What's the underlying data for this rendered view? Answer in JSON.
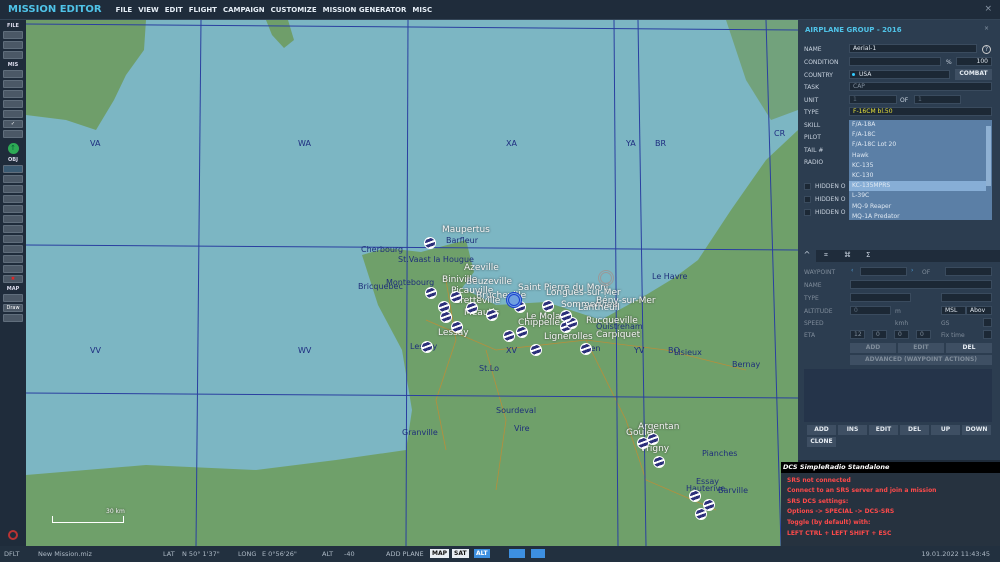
{
  "app": {
    "title": "MISSION EDITOR",
    "menu": [
      "FILE",
      "VIEW",
      "EDIT",
      "FLIGHT",
      "CAMPAIGN",
      "CUSTOMIZE",
      "MISSION GENERATOR",
      "MISC"
    ],
    "close": "×"
  },
  "toolbar": {
    "sections": [
      "FILE",
      "MIS",
      "OBJ",
      "MAP"
    ],
    "draw": "Draw"
  },
  "map": {
    "grid": [
      "VA",
      "WA",
      "XA",
      "YA",
      "BR",
      "CR",
      "VV",
      "WV",
      "XV",
      "YV",
      "BQ"
    ],
    "towns": [
      "Maupertus",
      "Barfleur",
      "Cherbourg",
      "St.Vaast la Hougue",
      "Azeville",
      "Beuzeville",
      "Biniville",
      "Picauville",
      "Brucheville",
      "Cretteville",
      "Meautis",
      "Lessay",
      "Montebourg",
      "Bricquebec",
      "Saint Pierre du Mont",
      "Longues-sur-Mer",
      "Sommervieu",
      "Bény-sur-Mer",
      "Lantheuil",
      "Le Molay",
      "Rucqueville",
      "Chippelle",
      "Lignerolles",
      "Carpiquet",
      "Ouistreham",
      "Caen",
      "Le Havre",
      "Lisieux",
      "Bernay",
      "St.Lo",
      "Sourdeval",
      "Vire",
      "Granville",
      "Argentan",
      "Goulet",
      "Vrigny",
      "Pianches",
      "Essay",
      "Hauterive",
      "Barville",
      "Lessay"
    ],
    "scale": "30 km"
  },
  "panel": {
    "title": "AIRPLANE GROUP - 2016",
    "close": "×",
    "help": "?",
    "labels": {
      "name": "NAME",
      "condition": "CONDITION",
      "country": "COUNTRY",
      "task": "TASK",
      "unit": "UNIT",
      "type": "TYPE",
      "skill": "SKILL",
      "pilot": "PILOT",
      "tail": "TAIL #",
      "radio": "RADIO",
      "of": "OF",
      "pct": "%"
    },
    "name": "Aerial-1",
    "condition_value": "100",
    "country": "USA",
    "combat": "COMBAT",
    "task": "CAP",
    "unit": "1",
    "unit_of": "1",
    "type": "F-16CM bl.50",
    "type_options": [
      "F/A-18A",
      "F/A-18C",
      "F/A-18C Lot 20",
      "Hawk",
      "KC-135",
      "KC-130",
      "KC-135MPRS",
      "L-39C",
      "MQ-9 Reaper",
      "MQ-1A Predator"
    ],
    "hidden": [
      "HIDDEN O",
      "HIDDEN O",
      "HIDDEN O"
    ],
    "wp": {
      "waypoint": "WAYPOINT",
      "of": "OF",
      "name": "NAME",
      "type": "TYPE",
      "altitude": "ALTITUDE",
      "alt_val": "0",
      "m": "m",
      "msl": "MSL",
      "above": "Abov",
      "speed": "SPEED",
      "kmh": "kmh",
      "gs": "GS",
      "eta": "ETA",
      "eta_h": "12",
      "eta_m": "0",
      "eta_s": "0",
      "eta_d": "0",
      "fix": "Fix time",
      "add": "ADD",
      "edit": "EDIT",
      "del": "DEL",
      "advanced": "ADVANCED (WAYPOINT ACTIONS)"
    },
    "actions": [
      "ADD",
      "INS",
      "EDIT",
      "DEL",
      "UP",
      "DOWN",
      "CLONE"
    ]
  },
  "srs": {
    "title": "DCS SimpleRadio Standalone",
    "lines": [
      "SRS not connected",
      "Connect to an SRS server and join a mission",
      "SRS DCS settings:",
      "Options -> SPECIAL -> DCS-SRS",
      "Toggle (by default) with:",
      "LEFT CTRL + LEFT SHIFT + ESC"
    ]
  },
  "status": {
    "profile": "DFLT",
    "file": "New Mission.miz",
    "lat_label": "LAT",
    "lat": "N 50° 1'37\"",
    "long_label": "LONG",
    "long": "E 0°56'26\"",
    "alt_label": "ALT",
    "alt": "-40",
    "add_plane": "ADD PLANE",
    "map": "MAP",
    "sat": "SAT",
    "alt_btn": "ALT",
    "datetime": "19.01.2022 11:43:45"
  }
}
